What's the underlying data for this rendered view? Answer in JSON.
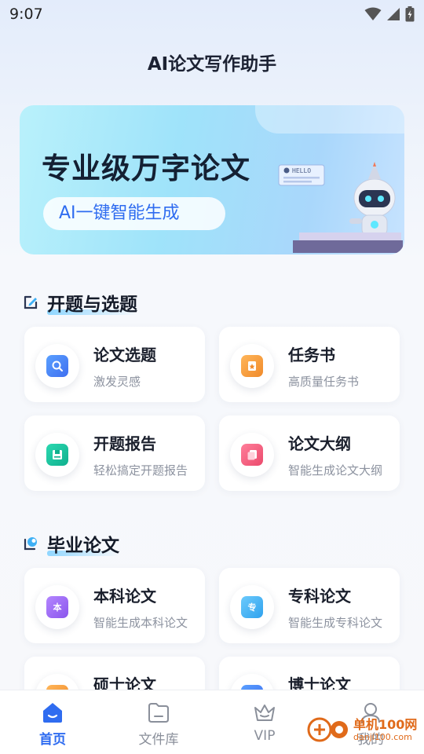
{
  "status_bar": {
    "time": "9:07"
  },
  "app": {
    "title": "AI论文写作助手"
  },
  "banner": {
    "headline": "专业级万字论文",
    "tagline": "AI一键智能生成",
    "robot_sign": "HELLO"
  },
  "sections": [
    {
      "title": "开题与选题",
      "cards": [
        {
          "title": "论文选题",
          "subtitle": "激发灵感",
          "icon": "search-icon",
          "color": "#3f7cf5"
        },
        {
          "title": "任务书",
          "subtitle": "高质量任务书",
          "icon": "task-icon",
          "color": "#f59b3a"
        },
        {
          "title": "开题报告",
          "subtitle": "轻松搞定开题报告",
          "icon": "report-icon",
          "color": "#17c3a0"
        },
        {
          "title": "论文大纲",
          "subtitle": "智能生成论文大纲",
          "icon": "outline-icon",
          "color": "#f0587a"
        }
      ]
    },
    {
      "title": "毕业论文",
      "cards": [
        {
          "title": "本科论文",
          "subtitle": "智能生成本科论文",
          "icon": "bachelor-icon",
          "icon_char": "本",
          "color": "#9a63f0"
        },
        {
          "title": "专科论文",
          "subtitle": "智能生成专科论文",
          "icon": "college-icon",
          "icon_char": "专",
          "color": "#3fb0f5"
        },
        {
          "title": "硕士论文",
          "subtitle": "",
          "icon": "master-icon",
          "color": "#f59b3a"
        },
        {
          "title": "博士论文",
          "subtitle": "",
          "icon": "doctor-icon",
          "color": "#3f7cf5"
        }
      ]
    }
  ],
  "bottom_nav": [
    {
      "label": "首页",
      "icon": "home-icon",
      "active": true
    },
    {
      "label": "文件库",
      "icon": "folder-icon",
      "active": false
    },
    {
      "label": "VIP",
      "icon": "crown-icon",
      "active": false
    },
    {
      "label": "我的",
      "icon": "profile-icon",
      "active": false
    }
  ],
  "colors": {
    "accent": "#2f6cf0",
    "title_text": "#1c2233",
    "sub_text": "#8d93a0"
  },
  "watermark": {
    "text": "单机100网",
    "sub": "danji100.com"
  }
}
